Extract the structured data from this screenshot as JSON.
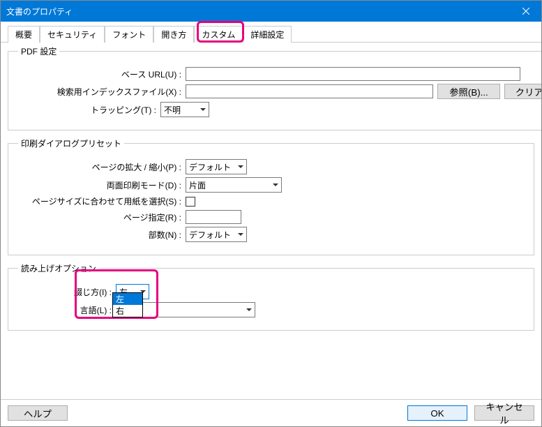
{
  "titlebar": {
    "title": "文書のプロパティ"
  },
  "tabs": {
    "items": [
      {
        "label": "概要"
      },
      {
        "label": "セキュリティ"
      },
      {
        "label": "フォント"
      },
      {
        "label": "開き方"
      },
      {
        "label": "カスタム"
      },
      {
        "label": "詳細設定"
      }
    ],
    "active_index": 5
  },
  "pdf_settings": {
    "legend": "PDF 設定",
    "base_url_label": "ベース URL(U) :",
    "base_url_value": "",
    "index_file_label": "検索用インデックスファイル(X) :",
    "index_file_value": "",
    "browse_label": "参照(B)...",
    "clear_label": "クリア(C)",
    "trapping_label": "トラッピング(T) :",
    "trapping_value": "不明"
  },
  "print_preset": {
    "legend": "印刷ダイアログプリセット",
    "scaling_label": "ページの拡大 / 縮小(P) :",
    "scaling_value": "デフォルト",
    "duplex_label": "両面印刷モード(D) :",
    "duplex_value": "片面",
    "paper_select_label": "ページサイズに合わせて用紙を選択(S) :",
    "paper_select_checked": false,
    "page_range_label": "ページ指定(R) :",
    "page_range_value": "",
    "copies_label": "部数(N) :",
    "copies_value": "デフォルト"
  },
  "reading_options": {
    "legend": "読み上げオプション",
    "binding_label": "綴じ方(I) :",
    "binding_value": "左",
    "binding_options": [
      "左",
      "右"
    ],
    "language_label": "言語(L) :",
    "language_value": ""
  },
  "footer": {
    "help": "ヘルプ",
    "ok": "OK",
    "cancel": "キャンセル"
  }
}
